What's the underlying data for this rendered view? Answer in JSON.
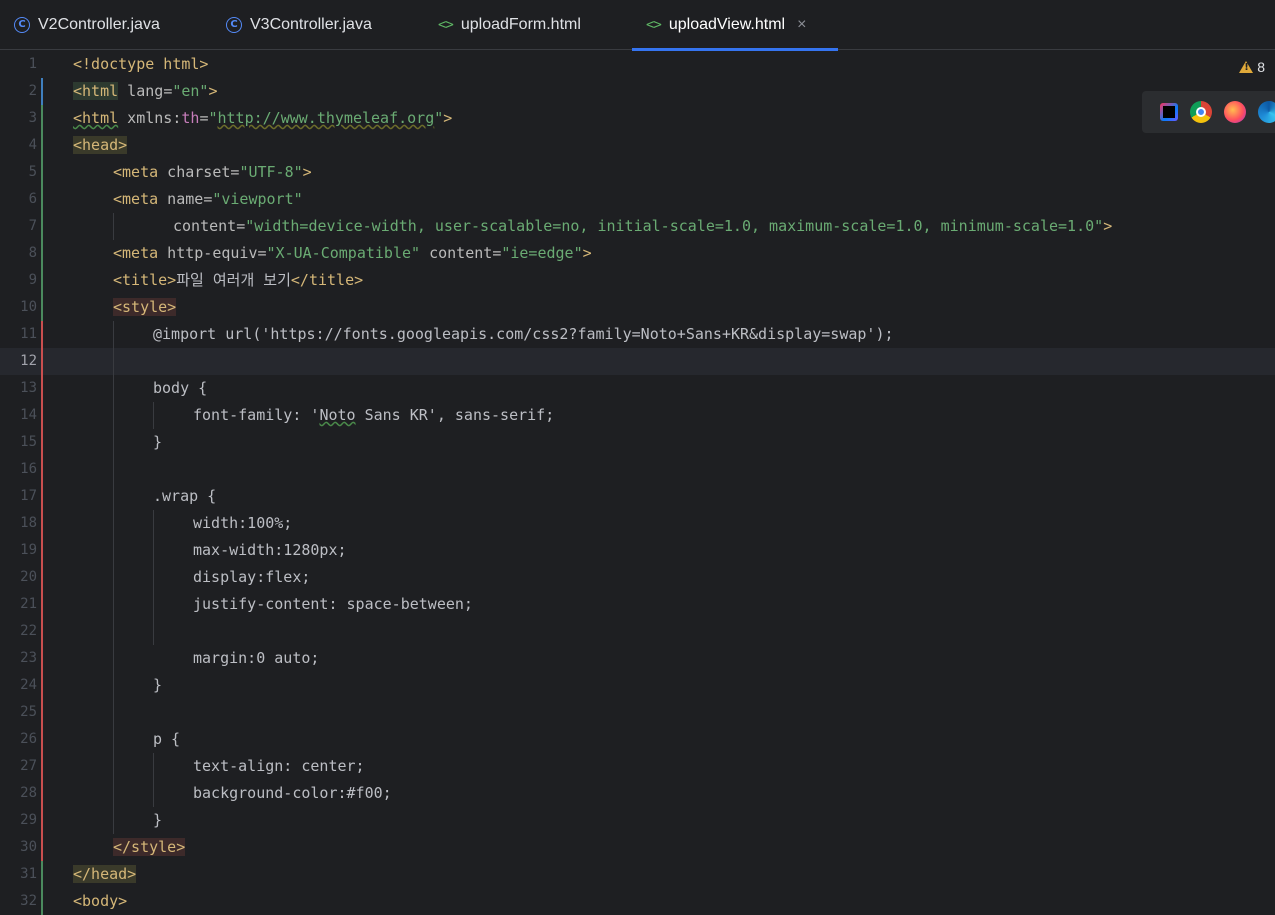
{
  "tabs": [
    {
      "label": "V2Controller.java",
      "icon": "java-class-icon",
      "active": false
    },
    {
      "label": "V3Controller.java",
      "icon": "java-class-icon",
      "active": false
    },
    {
      "label": "uploadForm.html",
      "icon": "html-file-icon",
      "active": false
    },
    {
      "label": "uploadView.html",
      "icon": "html-file-icon",
      "active": true
    }
  ],
  "tab_icons": {
    "class_letter": "C",
    "html_glyph": "<>",
    "close_glyph": "×"
  },
  "inspections": {
    "warning_count": "8"
  },
  "current_line": 12,
  "gutter": [
    "1",
    "2",
    "3",
    "4",
    "5",
    "6",
    "7",
    "8",
    "9",
    "10",
    "11",
    "12",
    "13",
    "14",
    "15",
    "16",
    "17",
    "18",
    "19",
    "20",
    "21",
    "22",
    "23",
    "24",
    "25",
    "26",
    "27",
    "28",
    "29",
    "30",
    "31",
    "32"
  ],
  "code": {
    "l1": {
      "t1": "<!doctype html>"
    },
    "l2": {
      "t1": "<html",
      "a1": " lang",
      "e": "=",
      "s1": "\"en\"",
      "t2": ">"
    },
    "l3": {
      "t1": "<html",
      "a1": " xmlns:",
      "ns": "th",
      "e": "=",
      "q1": "\"",
      "url": "http://www.thymeleaf.org",
      "q2": "\"",
      "t2": ">"
    },
    "l4": {
      "t1": "<head>"
    },
    "l5": {
      "t1": "<meta",
      "a1": " charset",
      "e": "=",
      "s1": "\"UTF-8\"",
      "t2": ">"
    },
    "l6": {
      "t1": "<meta",
      "a1": " name",
      "e": "=",
      "s1": "\"viewport\""
    },
    "l7": {
      "a1": "content",
      "e": "=",
      "s1": "\"width=device-width, user-scalable=no, initial-scale=1.0, maximum-scale=1.0, minimum-scale=1.0\"",
      "t2": ">"
    },
    "l8": {
      "t1": "<meta",
      "a1": " http-equiv",
      "e": "=",
      "s1": "\"X-UA-Compatible\"",
      "a2": " content",
      "e2": "=",
      "s2": "\"ie=edge\"",
      "t2": ">"
    },
    "l9": {
      "t1": "<title>",
      "txt": "파일 여러개 보기",
      "t2": "</title>"
    },
    "l10": {
      "t1": "<style>"
    },
    "l11": {
      "txt": "@import url('https://fonts.googleapis.com/css2?family=Noto+Sans+KR&display=swap');"
    },
    "l12": {
      "txt": ""
    },
    "l13": {
      "txt": "body {"
    },
    "l14": {
      "p1": "font-family: '",
      "w": "Noto",
      "p2": " Sans KR', sans-serif;"
    },
    "l15": {
      "txt": "}"
    },
    "l16": {
      "txt": ""
    },
    "l17": {
      "txt": ".wrap {"
    },
    "l18": {
      "txt": "width:100%;"
    },
    "l19": {
      "txt": "max-width:1280px;"
    },
    "l20": {
      "txt": "display:flex;"
    },
    "l21": {
      "txt": "justify-content: space-between;"
    },
    "l22": {
      "txt": ""
    },
    "l23": {
      "txt": "margin:0 auto;"
    },
    "l24": {
      "txt": "}"
    },
    "l25": {
      "txt": ""
    },
    "l26": {
      "txt": "p {"
    },
    "l27": {
      "txt": "text-align: center;"
    },
    "l28": {
      "txt": "background-color:#f00;"
    },
    "l29": {
      "txt": "}"
    },
    "l30": {
      "t1": "</style>"
    },
    "l31": {
      "t1": "</head>"
    },
    "l32": {
      "t1": "<body>"
    }
  },
  "browsers": [
    "intellij-icon",
    "chrome-icon",
    "firefox-icon",
    "edge-icon"
  ]
}
